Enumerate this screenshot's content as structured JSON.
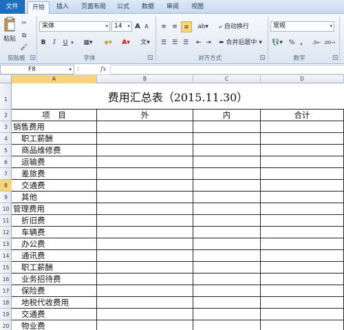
{
  "menu": {
    "file": "文件",
    "tabs": [
      "开始",
      "插入",
      "页面布局",
      "公式",
      "数据",
      "审阅",
      "视图"
    ]
  },
  "ribbon": {
    "groups": [
      "剪贴板",
      "字体",
      "对齐方式",
      "数字"
    ],
    "paste_label": "粘贴",
    "font_name": "宋体",
    "font_size": "14",
    "wrap_text": "自动换行",
    "merge_center": "合并后居中",
    "number_format": "常规",
    "bold": "B",
    "italic": "I",
    "underline": "U",
    "grow_font": "A",
    "shrink_font": "A",
    "percent": "%"
  },
  "formula_bar": {
    "name_box": "F8",
    "fx": "fx"
  },
  "grid": {
    "columns": [
      "A",
      "B",
      "C",
      "D"
    ],
    "selected_column": "A",
    "selected_row": "8",
    "title": "费用汇总表（2015.11.30）",
    "header_row": {
      "a": "项　目",
      "b": "外",
      "c": "内",
      "d": "合计"
    },
    "rows": [
      {
        "num": "1"
      },
      {
        "num": "2"
      },
      {
        "num": "3",
        "a": "销售费用"
      },
      {
        "num": "4",
        "a": "职工薪酬"
      },
      {
        "num": "5",
        "a": "商品维修费"
      },
      {
        "num": "6",
        "a": "运输费"
      },
      {
        "num": "7",
        "a": "差旅费"
      },
      {
        "num": "8",
        "a": "交通费"
      },
      {
        "num": "9",
        "a": "其他"
      },
      {
        "num": "10",
        "a": "管理费用"
      },
      {
        "num": "11",
        "a": "折旧费"
      },
      {
        "num": "12",
        "a": "车辆费"
      },
      {
        "num": "13",
        "a": "办公费"
      },
      {
        "num": "14",
        "a": "通讯费"
      },
      {
        "num": "15",
        "a": "职工薪酬"
      },
      {
        "num": "16",
        "a": "业务招待费"
      },
      {
        "num": "17",
        "a": "保险费"
      },
      {
        "num": "18",
        "a": "地税代收费用"
      },
      {
        "num": "19",
        "a": "交通费"
      },
      {
        "num": "20",
        "a": "物业费"
      }
    ]
  },
  "colors": {
    "file_tab": "#1f6fbf",
    "selection_header": "#f7d37a",
    "highlight_button": "#fbd776"
  }
}
